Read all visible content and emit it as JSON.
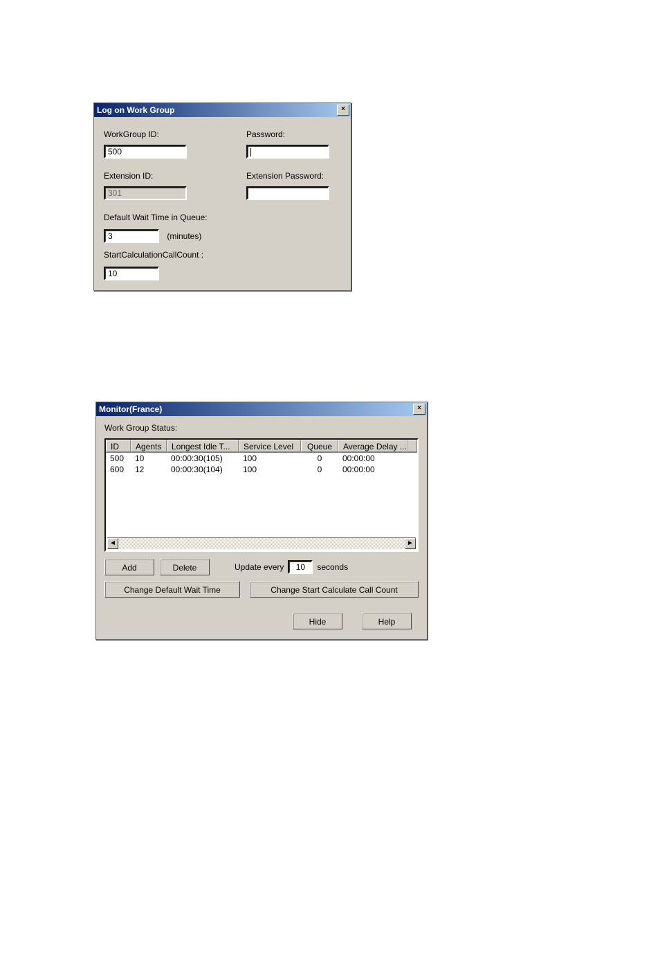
{
  "logon": {
    "title": "Log on Work Group",
    "workgroup_id_label": "WorkGroup ID:",
    "workgroup_id_value": "500",
    "password_label": "Password:",
    "password_value": "",
    "extension_id_label": "Extension ID:",
    "extension_id_value": "301",
    "extension_pw_label": "Extension Password:",
    "extension_pw_value": "",
    "default_wait_label": "Default Wait Time in Queue:",
    "default_wait_value": "3",
    "default_wait_unit": "(minutes)",
    "start_calc_label": "StartCalculationCallCount :",
    "start_calc_value": "10"
  },
  "monitor": {
    "title": "Monitor(France)",
    "status_label": "Work Group Status:",
    "columns": {
      "id": "ID",
      "agents": "Agents",
      "idle": "Longest Idle T...",
      "sl": "Service Level",
      "queue": "Queue",
      "avg": "Average Delay ..."
    },
    "rows": [
      {
        "id": "500",
        "agents": "10",
        "idle": "00:00:30(105)",
        "sl": "100",
        "queue": "0",
        "avg": "00:00:00"
      },
      {
        "id": "600",
        "agents": "12",
        "idle": "00:00:30(104)",
        "sl": "100",
        "queue": "0",
        "avg": "00:00:00"
      }
    ],
    "add_label": "Add",
    "delete_label": "Delete",
    "update_prefix": "Update every",
    "update_value": "10",
    "update_suffix": "seconds",
    "change_wait_label": "Change Default Wait Time",
    "change_calc_label": "Change Start Calculate Call Count",
    "hide_label": "Hide",
    "help_label": "Help"
  }
}
